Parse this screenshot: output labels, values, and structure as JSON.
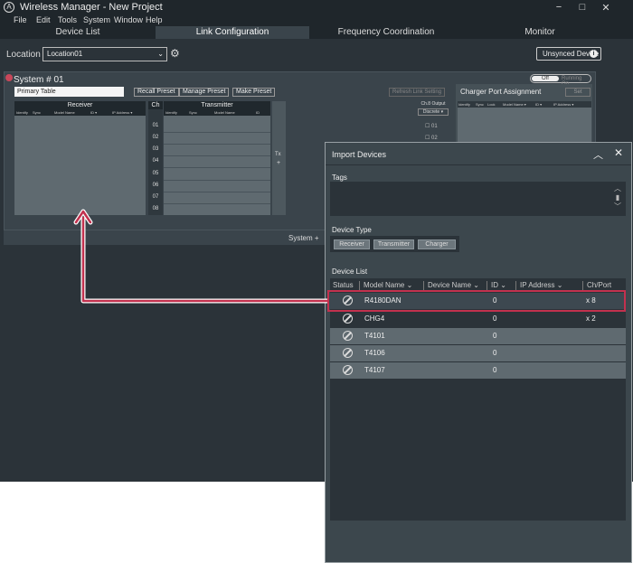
{
  "app": {
    "title": "Wireless Manager - New Project",
    "logo": "A",
    "window_controls": {
      "minimize": "−",
      "maximize": "□",
      "close": "✕"
    }
  },
  "menu": [
    "File",
    "Edit",
    "Tools",
    "System",
    "Window",
    "Help"
  ],
  "nav_tabs": [
    {
      "label": "Device List"
    },
    {
      "label": "Link Configuration",
      "active": true
    },
    {
      "label": "Frequency Coordination"
    },
    {
      "label": "Monitor"
    }
  ],
  "location": {
    "label": "Location",
    "value": "Location01",
    "gear": "⚙"
  },
  "unsynced_button": "Unsynced Device",
  "system": {
    "title": "System # 01",
    "toggle_off": "Off",
    "toggle_running": "Running On",
    "table_name": "Primary Table",
    "buttons": [
      "Recall Preset",
      "Manage Preset",
      "Make Preset"
    ],
    "refresh": "Refresh Link Setting",
    "receiver_header": "Receiver",
    "receiver_cols": [
      "Identify",
      "Sync",
      "Model Name",
      "ID ▾",
      "IP Address ▾"
    ],
    "ch_header": "Ch",
    "channels": [
      "01",
      "02",
      "03",
      "04",
      "05",
      "06",
      "07",
      "08"
    ],
    "transmitter_header": "Transmitter",
    "transmitter_cols": [
      "Identify",
      "Sync",
      "Model Name",
      "ID"
    ],
    "tx_label": "Tx",
    "tx_plus": "+",
    "ch8_output_title": "Ch.8 Output",
    "ch8_output_value": "Discrete ▾",
    "ch8_rows": [
      "01",
      "02"
    ],
    "charger_title": "Charger Port Assignment",
    "charger_set": "Set",
    "charger_cols": [
      "Identify",
      "Sync",
      "Lock",
      "Model Name ▾",
      "ID ▾",
      "IP Address ▾"
    ],
    "system_plus": "System +"
  },
  "dialog": {
    "title": "Import Devices",
    "tags_label": "Tags",
    "device_type_label": "Device Type",
    "device_types": [
      "Receiver",
      "Transmitter",
      "Charger"
    ],
    "device_list_label": "Device List",
    "columns": [
      "Status",
      "Model Name",
      "Device Name",
      "ID",
      "IP Address",
      "Ch/Port"
    ],
    "devices": [
      {
        "model": "R4180DAN",
        "id": "0",
        "ch": "x 8"
      },
      {
        "model": "CHG4",
        "id": "0",
        "ch": "x 2"
      },
      {
        "model": "T4101",
        "id": "0",
        "ch": ""
      },
      {
        "model": "T4106",
        "id": "0",
        "ch": ""
      },
      {
        "model": "T4107",
        "id": "0",
        "ch": ""
      }
    ]
  },
  "colors": {
    "highlight": "#c2314e",
    "background": "#2b3339"
  }
}
